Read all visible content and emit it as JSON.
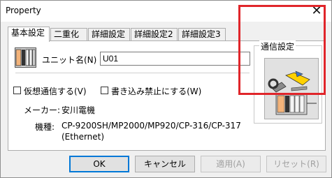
{
  "window": {
    "title": "Property",
    "close_glyph": "✕"
  },
  "tabs": [
    {
      "label": "基本設定",
      "active": true
    },
    {
      "label": "二重化",
      "active": false
    },
    {
      "label": "詳細設定",
      "active": false
    },
    {
      "label": "詳細設定2",
      "active": false
    },
    {
      "label": "詳細設定3",
      "active": false
    }
  ],
  "unit": {
    "label": "ユニット名(N) :",
    "value": "U01"
  },
  "options": {
    "virtual_comm_label": "仮想通信する(V)",
    "write_protect_label": "書き込み禁止にする(W)"
  },
  "info": {
    "maker_label": "メーカー:",
    "maker_value": "安川電機",
    "model_label": "機種:",
    "model_value": "CP-9200SH/MP2000/MP920/CP-316/CP-317",
    "model_value_2": "(Ethernet)"
  },
  "comm_group": {
    "legend": "通信設定"
  },
  "buttons": {
    "ok": "OK",
    "cancel": "キャンセル",
    "apply": "適用(A)",
    "reset": "リセット(R)"
  },
  "colors": {
    "highlight": "#e0252a",
    "accent": "#0078d7"
  }
}
